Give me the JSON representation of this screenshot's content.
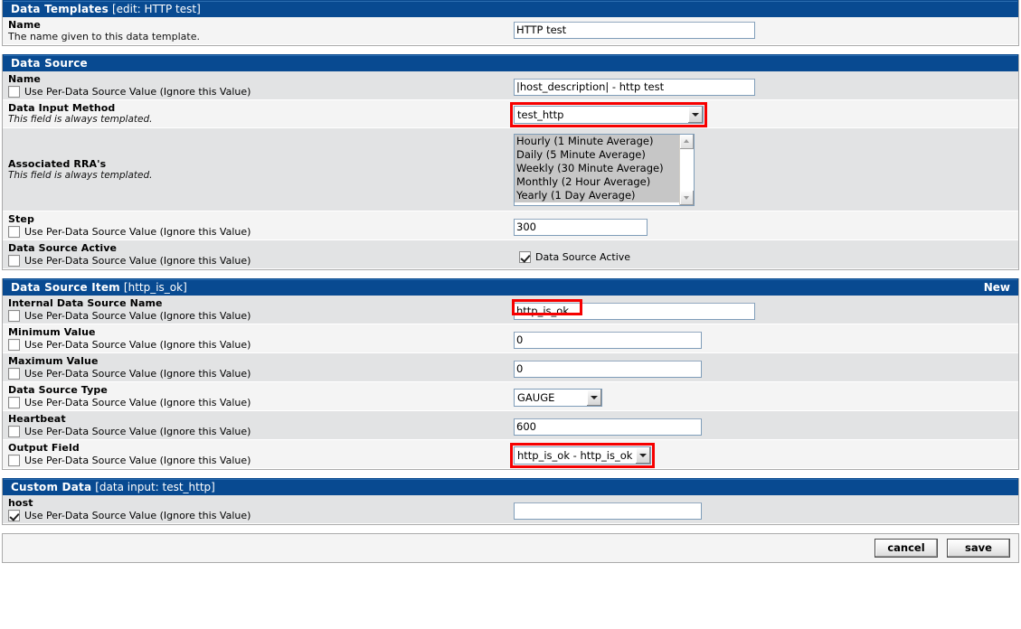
{
  "common": {
    "per_ds_label": "Use Per-Data Source Value (Ignore this Value)"
  },
  "sections": {
    "data_templates": {
      "title": "Data Templates",
      "subtitle": "[edit: HTTP test]",
      "rows": {
        "name": {
          "label": "Name",
          "desc": "The name given to this data template.",
          "value": "HTTP test"
        }
      }
    },
    "data_source": {
      "title": "Data Source",
      "subtitle": "",
      "rows": {
        "name": {
          "label": "Name",
          "checkbox_label": "Use Per-Data Source Value (Ignore this Value)",
          "checked": false,
          "value": "|host_description| - http test"
        },
        "data_input_method": {
          "label": "Data Input Method",
          "desc": "This field is always templated.",
          "value": "test_http",
          "highlighted": true
        },
        "associated_rras": {
          "label": "Associated RRA's",
          "desc": "This field is always templated.",
          "options": [
            "Hourly (1 Minute Average)",
            "Daily (5 Minute Average)",
            "Weekly (30 Minute Average)",
            "Monthly (2 Hour Average)",
            "Yearly (1 Day Average)"
          ]
        },
        "step": {
          "label": "Step",
          "checkbox_label": "Use Per-Data Source Value (Ignore this Value)",
          "checked": false,
          "value": "300"
        },
        "data_source_active": {
          "label": "Data Source Active",
          "checkbox_label": "Use Per-Data Source Value (Ignore this Value)",
          "checked": false,
          "field_checkbox_label": "Data Source Active",
          "field_checked": true
        }
      }
    },
    "data_source_item": {
      "title": "Data Source Item",
      "subtitle": "[http_is_ok]",
      "action": "New",
      "rows": {
        "internal_name": {
          "label": "Internal Data Source Name",
          "checkbox_label": "Use Per-Data Source Value (Ignore this Value)",
          "checked": false,
          "value": "http_is_ok",
          "highlighted": true
        },
        "minimum_value": {
          "label": "Minimum Value",
          "checkbox_label": "Use Per-Data Source Value (Ignore this Value)",
          "checked": false,
          "value": "0"
        },
        "maximum_value": {
          "label": "Maximum Value",
          "checkbox_label": "Use Per-Data Source Value (Ignore this Value)",
          "checked": false,
          "value": "0"
        },
        "data_source_type": {
          "label": "Data Source Type",
          "checkbox_label": "Use Per-Data Source Value (Ignore this Value)",
          "checked": false,
          "value": "GAUGE"
        },
        "heartbeat": {
          "label": "Heartbeat",
          "checkbox_label": "Use Per-Data Source Value (Ignore this Value)",
          "checked": false,
          "value": "600"
        },
        "output_field": {
          "label": "Output Field",
          "checkbox_label": "Use Per-Data Source Value (Ignore this Value)",
          "checked": false,
          "value": "http_is_ok - http_is_ok",
          "highlighted": true
        }
      }
    },
    "custom_data": {
      "title": "Custom Data",
      "subtitle": "[data input: test_http]",
      "rows": {
        "host": {
          "label": "host",
          "checkbox_label": "Use Per-Data Source Value (Ignore this Value)",
          "checked": true,
          "value": ""
        }
      }
    }
  },
  "footer": {
    "cancel_label": "cancel",
    "save_label": "save"
  },
  "colors": {
    "header_blue": "#084a91",
    "row_light": "#f4f4f4",
    "row_dark": "#e2e3e4",
    "highlight_red": "#f60000"
  }
}
